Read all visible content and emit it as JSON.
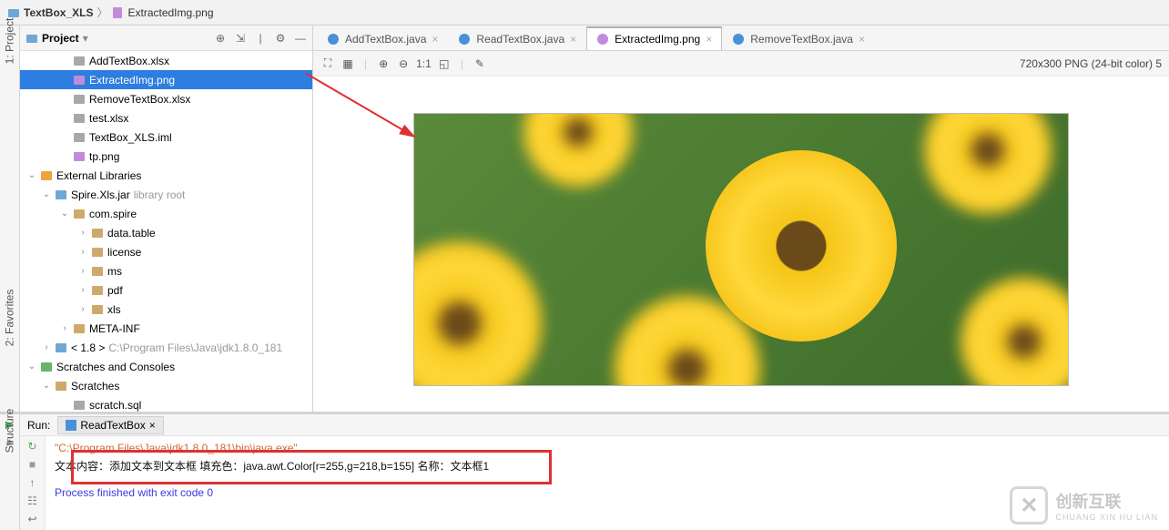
{
  "breadcrumb": {
    "root": "TextBox_XLS",
    "file": "ExtractedImg.png"
  },
  "left_rail": {
    "project": "1: Project",
    "favorites": "2: Favorites",
    "structure": "Structure"
  },
  "sidebar": {
    "title": "Project",
    "tree": [
      {
        "l": 2,
        "a": "",
        "icon": "xlsx",
        "label": "AddTextBox.xlsx"
      },
      {
        "l": 2,
        "a": "",
        "icon": "png",
        "label": "ExtractedImg.png",
        "sel": true
      },
      {
        "l": 2,
        "a": "",
        "icon": "xlsx",
        "label": "RemoveTextBox.xlsx"
      },
      {
        "l": 2,
        "a": "",
        "icon": "xlsx",
        "label": "test.xlsx"
      },
      {
        "l": 2,
        "a": "",
        "icon": "iml",
        "label": "TextBox_XLS.iml"
      },
      {
        "l": 2,
        "a": "",
        "icon": "png",
        "label": "tp.png"
      },
      {
        "l": 0,
        "a": "v",
        "icon": "lib",
        "label": "External Libraries"
      },
      {
        "l": 1,
        "a": "v",
        "icon": "jar",
        "label": "Spire.Xls.jar",
        "suffix": "library root"
      },
      {
        "l": 2,
        "a": "v",
        "icon": "pkg",
        "label": "com.spire"
      },
      {
        "l": 3,
        "a": ">",
        "icon": "pkg",
        "label": "data.table"
      },
      {
        "l": 3,
        "a": ">",
        "icon": "pkg",
        "label": "license"
      },
      {
        "l": 3,
        "a": ">",
        "icon": "pkg",
        "label": "ms"
      },
      {
        "l": 3,
        "a": ">",
        "icon": "pkg",
        "label": "pdf"
      },
      {
        "l": 3,
        "a": ">",
        "icon": "pkg",
        "label": "xls"
      },
      {
        "l": 2,
        "a": ">",
        "icon": "pkg",
        "label": "META-INF"
      },
      {
        "l": 1,
        "a": ">",
        "icon": "jdk",
        "label": "< 1.8 >",
        "suffix": "C:\\Program Files\\Java\\jdk1.8.0_181"
      },
      {
        "l": 0,
        "a": "v",
        "icon": "scr",
        "label": "Scratches and Consoles"
      },
      {
        "l": 1,
        "a": "v",
        "icon": "folder",
        "label": "Scratches"
      },
      {
        "l": 2,
        "a": "",
        "icon": "sql",
        "label": "scratch.sql"
      }
    ]
  },
  "tabs": [
    {
      "label": "AddTextBox.java",
      "icon": "java"
    },
    {
      "label": "ReadTextBox.java",
      "icon": "java"
    },
    {
      "label": "ExtractedImg.png",
      "icon": "png",
      "active": true
    },
    {
      "label": "RemoveTextBox.java",
      "icon": "java"
    }
  ],
  "image": {
    "info": "720x300 PNG (24-bit color) 5",
    "ratio_label": "1:1"
  },
  "run": {
    "label": "Run:",
    "tab": "ReadTextBox",
    "cmd": "\"C:\\Program Files\\Java\\jdk1.8.0_181\\bin\\java.exe\" ...",
    "output": "文本内容：添加文本到文本框 填充色：java.awt.Color[r=255,g=218,b=155] 名称：文本框1",
    "exit": "Process finished with exit code 0"
  },
  "logo": {
    "brand": "创新互联",
    "pinyin": "CHUANG XIN HU LIAN"
  }
}
